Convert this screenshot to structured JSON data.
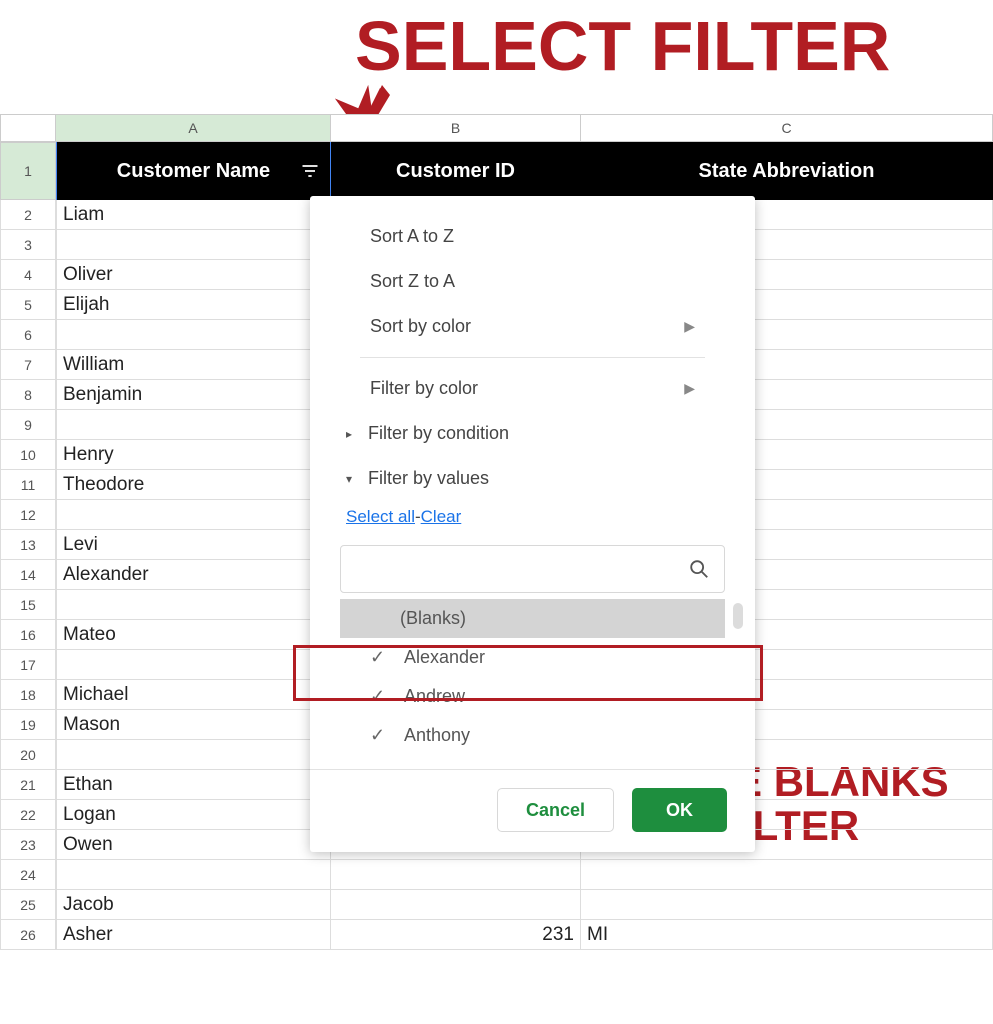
{
  "annotations": {
    "top": "SELECT FILTER",
    "bottom_line1": "REMOVE BLANKS",
    "bottom_line2": "FROM FILTER"
  },
  "columns": {
    "A": "A",
    "B": "B",
    "C": "C"
  },
  "headers": {
    "A": "Customer Name",
    "B": "Customer ID",
    "C": "State Abbreviation"
  },
  "rows": [
    {
      "n": "1"
    },
    {
      "n": "2",
      "a": "Liam"
    },
    {
      "n": "3",
      "a": ""
    },
    {
      "n": "4",
      "a": "Oliver"
    },
    {
      "n": "5",
      "a": "Elijah"
    },
    {
      "n": "6",
      "a": ""
    },
    {
      "n": "7",
      "a": "William"
    },
    {
      "n": "8",
      "a": "Benjamin"
    },
    {
      "n": "9",
      "a": ""
    },
    {
      "n": "10",
      "a": "Henry"
    },
    {
      "n": "11",
      "a": "Theodore"
    },
    {
      "n": "12",
      "a": ""
    },
    {
      "n": "13",
      "a": "Levi"
    },
    {
      "n": "14",
      "a": "Alexander"
    },
    {
      "n": "15",
      "a": ""
    },
    {
      "n": "16",
      "a": "Mateo"
    },
    {
      "n": "17",
      "a": ""
    },
    {
      "n": "18",
      "a": "Michael"
    },
    {
      "n": "19",
      "a": "Mason"
    },
    {
      "n": "20",
      "a": ""
    },
    {
      "n": "21",
      "a": "Ethan"
    },
    {
      "n": "22",
      "a": "Logan"
    },
    {
      "n": "23",
      "a": "Owen"
    },
    {
      "n": "24",
      "a": ""
    },
    {
      "n": "25",
      "a": "Jacob"
    },
    {
      "n": "26",
      "a": "Asher",
      "b": "231",
      "c": "MI"
    }
  ],
  "filter": {
    "sort_az": "Sort A to Z",
    "sort_za": "Sort Z to A",
    "sort_color": "Sort by color",
    "filter_color": "Filter by color",
    "filter_condition": "Filter by condition",
    "filter_values": "Filter by values",
    "select_all": "Select all",
    "clear": "Clear",
    "separator": "-",
    "search_placeholder": "",
    "values": {
      "blanks": "(Blanks)",
      "v1": "Alexander",
      "v2": "Andrew",
      "v3": "Anthony"
    },
    "cancel": "Cancel",
    "ok": "OK"
  }
}
